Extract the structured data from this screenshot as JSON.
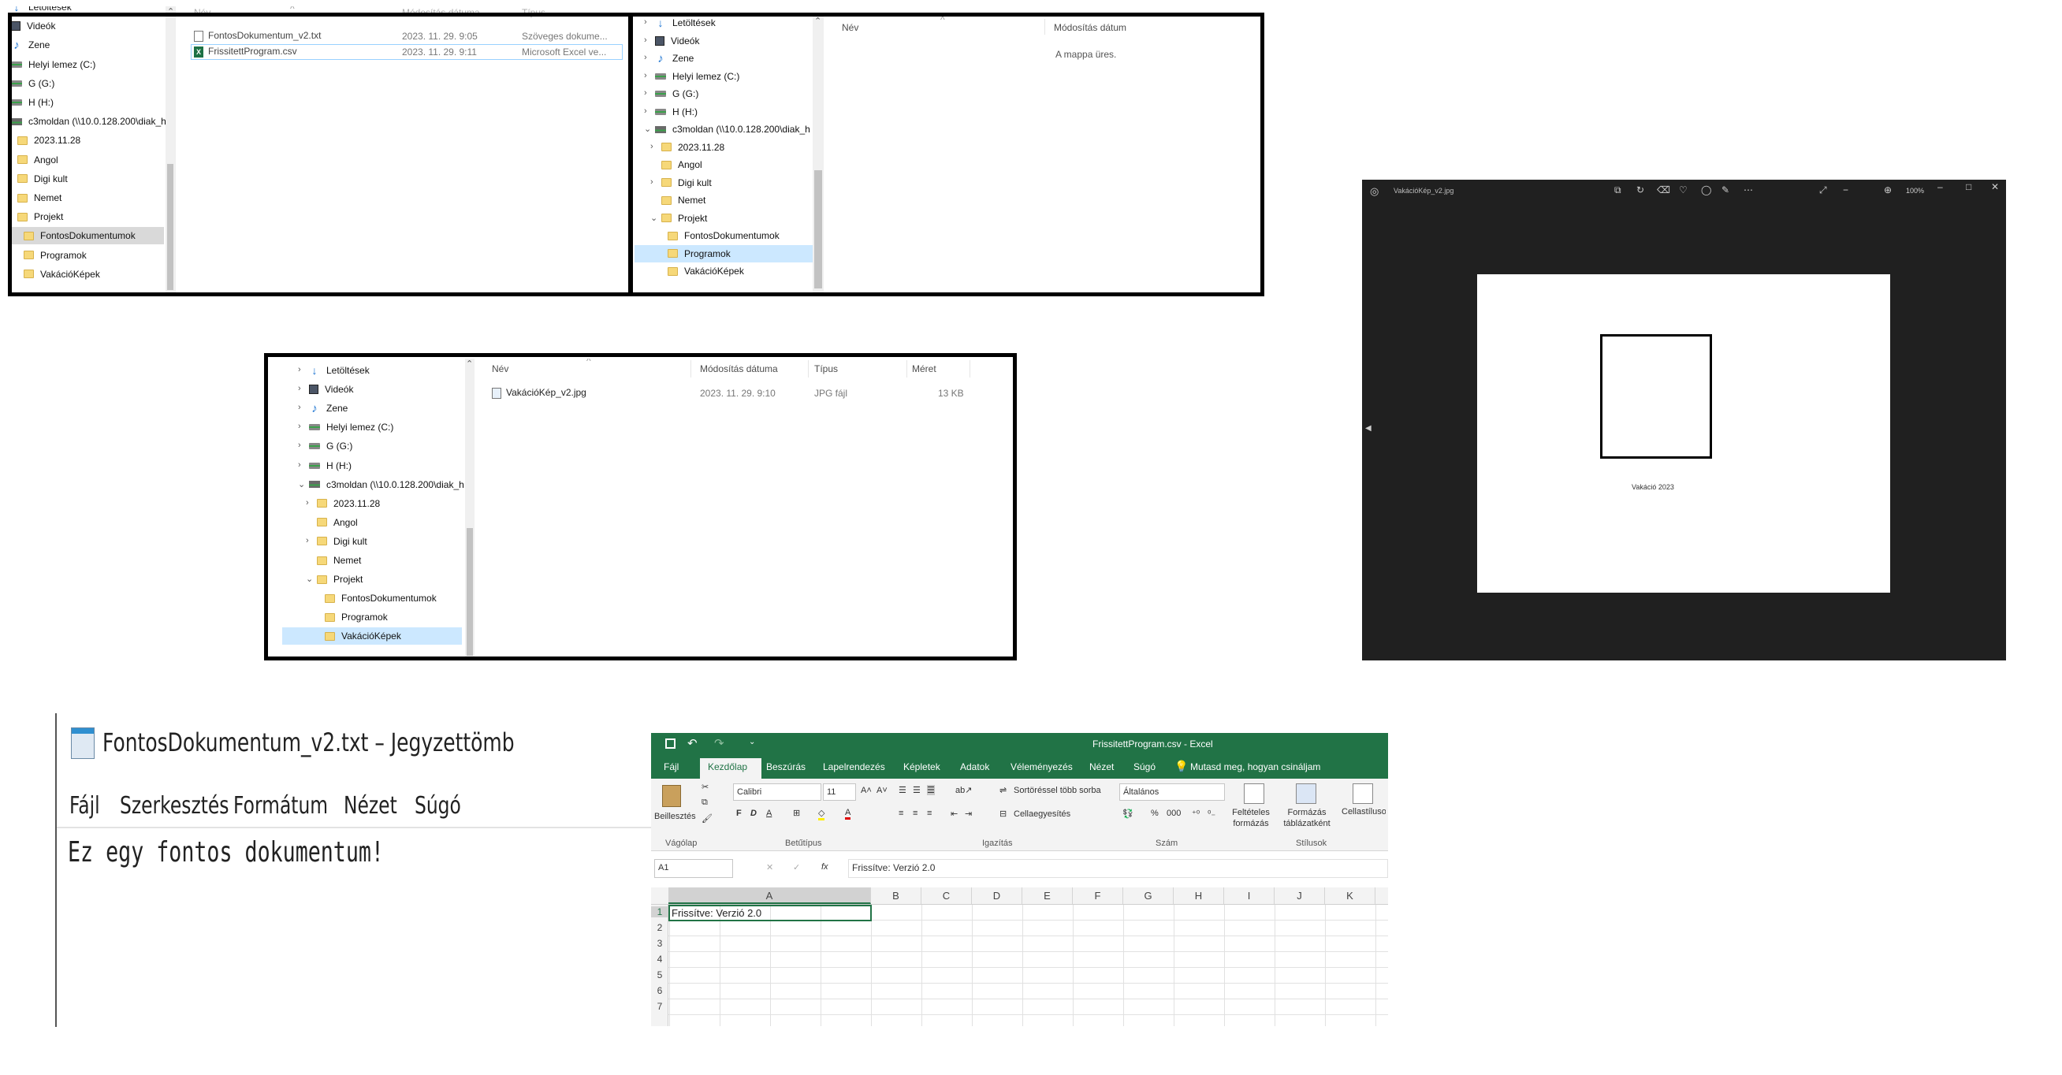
{
  "explorer1": {
    "nav": [
      {
        "label": "Letöltések",
        "icon": "download-icon"
      },
      {
        "label": "Videók",
        "icon": "video-icon"
      },
      {
        "label": "Zene",
        "icon": "music-icon"
      },
      {
        "label": "Helyi lemez (C:)",
        "icon": "drive-icon"
      },
      {
        "label": "G (G:)",
        "icon": "drive-icon"
      },
      {
        "label": "H (H:)",
        "icon": "drive-icon"
      },
      {
        "label": "c3moldan (\\\\10.0.128.200\\diak_h",
        "icon": "network-drive-icon"
      },
      {
        "label": "2023.11.28",
        "icon": "folder-icon"
      },
      {
        "label": "Angol",
        "icon": "folder-icon"
      },
      {
        "label": "Digi kult",
        "icon": "folder-icon"
      },
      {
        "label": "Nemet",
        "icon": "folder-icon"
      },
      {
        "label": "Projekt",
        "icon": "folder-icon"
      },
      {
        "label": "FontosDokumentumok",
        "icon": "folder-icon"
      },
      {
        "label": "Programok",
        "icon": "folder-icon"
      },
      {
        "label": "VakációKépek",
        "icon": "folder-icon"
      }
    ],
    "headers": {
      "name": "Név",
      "modified": "Módosítás dátuma",
      "type": "Típus"
    },
    "files": [
      {
        "name": "FontosDokumentum_v2.txt",
        "modified": "2023. 11. 29. 9:05",
        "type": "Szöveges dokume..."
      },
      {
        "name": "FrissitettProgram.csv",
        "modified": "2023. 11. 29. 9:11",
        "type": "Microsoft Excel ve..."
      }
    ]
  },
  "explorer2": {
    "nav": [
      {
        "label": "Letöltések",
        "icon": "download-icon"
      },
      {
        "label": "Videók",
        "icon": "video-icon"
      },
      {
        "label": "Zene",
        "icon": "music-icon"
      },
      {
        "label": "Helyi lemez (C:)",
        "icon": "drive-icon"
      },
      {
        "label": "G (G:)",
        "icon": "drive-icon"
      },
      {
        "label": "H (H:)",
        "icon": "drive-icon"
      },
      {
        "label": "c3moldan (\\\\10.0.128.200\\diak_h",
        "icon": "network-drive-icon"
      },
      {
        "label": "2023.11.28",
        "icon": "folder-icon"
      },
      {
        "label": "Angol",
        "icon": "folder-icon"
      },
      {
        "label": "Digi kult",
        "icon": "folder-icon"
      },
      {
        "label": "Nemet",
        "icon": "folder-icon"
      },
      {
        "label": "Projekt",
        "icon": "folder-icon"
      },
      {
        "label": "FontosDokumentumok",
        "icon": "folder-icon"
      },
      {
        "label": "Programok",
        "icon": "folder-icon"
      },
      {
        "label": "VakációKépek",
        "icon": "folder-icon"
      }
    ],
    "headers": {
      "name": "Név",
      "modified": "Módosítás dátum"
    },
    "empty_text": "A mappa üres."
  },
  "explorer3": {
    "nav": [
      {
        "label": "Letöltések",
        "icon": "download-icon"
      },
      {
        "label": "Videók",
        "icon": "video-icon"
      },
      {
        "label": "Zene",
        "icon": "music-icon"
      },
      {
        "label": "Helyi lemez (C:)",
        "icon": "drive-icon"
      },
      {
        "label": "G (G:)",
        "icon": "drive-icon"
      },
      {
        "label": "H (H:)",
        "icon": "drive-icon"
      },
      {
        "label": "c3moldan (\\\\10.0.128.200\\diak_h",
        "icon": "network-drive-icon"
      },
      {
        "label": "2023.11.28",
        "icon": "folder-icon"
      },
      {
        "label": "Angol",
        "icon": "folder-icon"
      },
      {
        "label": "Digi kult",
        "icon": "folder-icon"
      },
      {
        "label": "Nemet",
        "icon": "folder-icon"
      },
      {
        "label": "Projekt",
        "icon": "folder-icon"
      },
      {
        "label": "FontosDokumentumok",
        "icon": "folder-icon"
      },
      {
        "label": "Programok",
        "icon": "folder-icon"
      },
      {
        "label": "VakációKépek",
        "icon": "folder-icon"
      }
    ],
    "headers": {
      "name": "Név",
      "modified": "Módosítás dátuma",
      "type": "Típus",
      "size": "Méret"
    },
    "files": [
      {
        "name": "VakációKép_v2.jpg",
        "modified": "2023. 11. 29. 9:10",
        "type": "JPG fájl",
        "size": "13 KB"
      }
    ]
  },
  "photo_viewer": {
    "title": "VakációKép_v2.jpg",
    "zoom": "100%",
    "image_caption": "Vakáció 2023"
  },
  "notepad": {
    "title": "FontosDokumentum_v2.txt – Jegyzettömb",
    "menu": [
      "Fájl",
      "Szerkesztés",
      "Formátum",
      "Nézet",
      "Súgó"
    ],
    "content": "Ez egy fontos dokumentum!"
  },
  "excel": {
    "title": "FrissitettProgram.csv - Excel",
    "tabs": [
      "Fájl",
      "Kezdőlap",
      "Beszúrás",
      "Lapelrendezés",
      "Képletek",
      "Adatok",
      "Véleményezés",
      "Nézet",
      "Súgó"
    ],
    "tell_me": "Mutasd meg, hogyan csináljam",
    "ribbon": {
      "paste": "Beillesztés",
      "font_name": "Calibri",
      "font_size": "11",
      "wrap": "Sortöréssel több sorba",
      "merge": "Cellaegyesítés",
      "number_format": "Általános",
      "cond_format": "Feltételes formázás",
      "format_table": "Formázás táblázatként",
      "cell_styles": "Cellastílusok",
      "groups": {
        "clipboard": "Vágólap",
        "font": "Betűtípus",
        "alignment": "Igazítás",
        "number": "Szám",
        "styles": "Stílusok"
      }
    },
    "name_box": "A1",
    "formula": "Frissítve: Verzió 2.0",
    "columns": [
      "A",
      "B",
      "C",
      "D",
      "E",
      "F",
      "G",
      "H",
      "I",
      "J",
      "K"
    ],
    "rows": [
      "1",
      "2",
      "3",
      "4",
      "5",
      "6",
      "7"
    ],
    "cell_a1": "Frissítve: Verzió 2.0"
  }
}
